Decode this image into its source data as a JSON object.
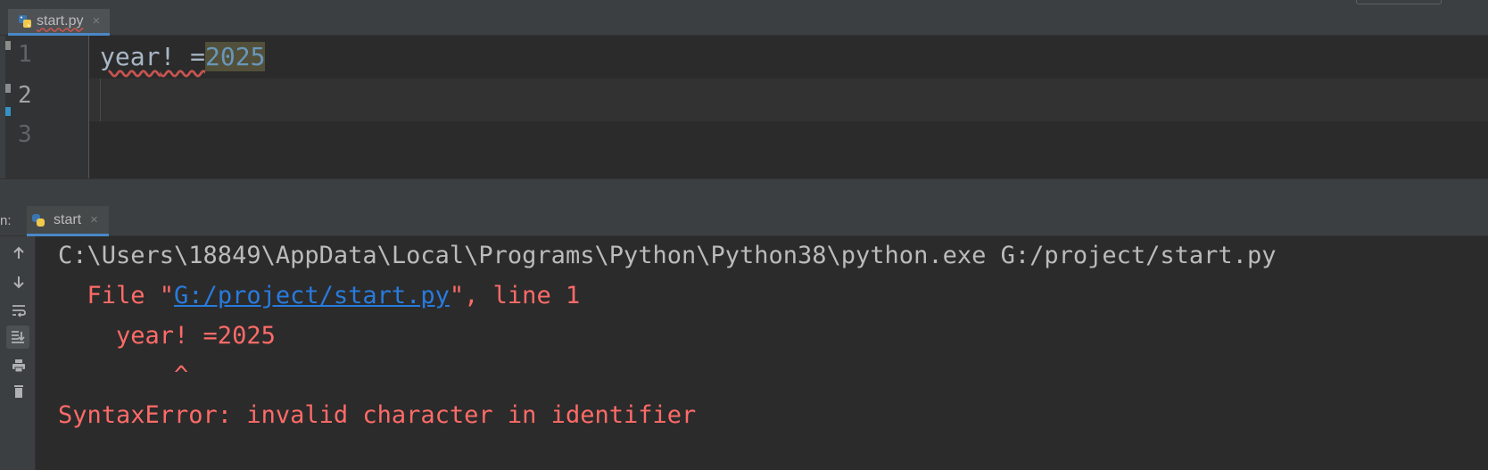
{
  "editor_tab": {
    "filename": "start.py",
    "close": "×"
  },
  "editor": {
    "line_numbers": [
      "1",
      "2",
      "3"
    ],
    "code": {
      "identifier": "year",
      "operator": "! =",
      "number": "2025"
    }
  },
  "run_panel": {
    "prefix": "n:",
    "tab_label": "start",
    "close": "×",
    "toolbar": [
      "arrow-up-icon",
      "arrow-down-icon",
      "soft-wrap-icon",
      "scroll-to-end-icon",
      "print-icon",
      "trash-icon"
    ]
  },
  "console": {
    "command": "C:\\Users\\18849\\AppData\\Local\\Programs\\Python\\Python38\\python.exe G:/project/start.py",
    "file_prefix": "  File \"",
    "file_link": "G:/project/start.py",
    "file_suffix": "\", line 1",
    "code_echo": "    year! =2025",
    "caret": "        ^",
    "error": "SyntaxError: invalid character in identifier"
  },
  "colors": {
    "error": "#ff6b68",
    "link": "#287bde",
    "number": "#6897bb",
    "accent": "#4a88c7"
  }
}
